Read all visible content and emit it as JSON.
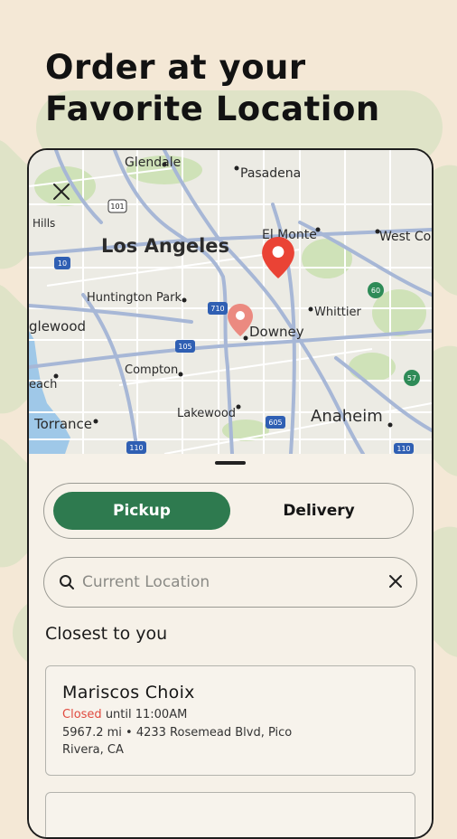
{
  "headline": {
    "line1": "Order at your",
    "line2": "Favorite Location"
  },
  "map": {
    "labels": {
      "glendale": "Glendale",
      "pasadena": "Pasadena",
      "el_monte": "El Monte",
      "west_covina": "West Co",
      "hills": "Hills",
      "los_angeles": "Los Angeles",
      "huntington_park": "Huntington Park",
      "whittier": "Whittier",
      "inglewood": "glewood",
      "downey": "Downey",
      "compton": "Compton",
      "beach": "each",
      "torrance": "Torrance",
      "lakewood": "Lakewood",
      "anaheim": "Anaheim"
    },
    "shields": {
      "s101": "101",
      "s10": "10",
      "s710": "710",
      "s105": "105",
      "s605": "605",
      "s110a": "110",
      "s110b": "110",
      "s60": "60",
      "s57": "57"
    },
    "icons": {
      "close": "close-icon",
      "selected_pin": "map-pin-icon",
      "secondary_pin": "map-pin-icon"
    }
  },
  "order_mode": {
    "pickup_label": "Pickup",
    "delivery_label": "Delivery",
    "selected": "Pickup"
  },
  "search": {
    "placeholder": "Current Location",
    "value": ""
  },
  "section_title": "Closest to you",
  "locations": [
    {
      "name": "Mariscos Choix",
      "status": "Closed",
      "status_detail": "until 11:00AM",
      "address": "5967.2 mi • 4233 Rosemead Blvd, Pico Rivera, CA"
    }
  ],
  "colors": {
    "accent": "#2e7a4f",
    "closed": "#e04a3f",
    "pin": "#ea4335",
    "background": "#f4e8d6"
  }
}
